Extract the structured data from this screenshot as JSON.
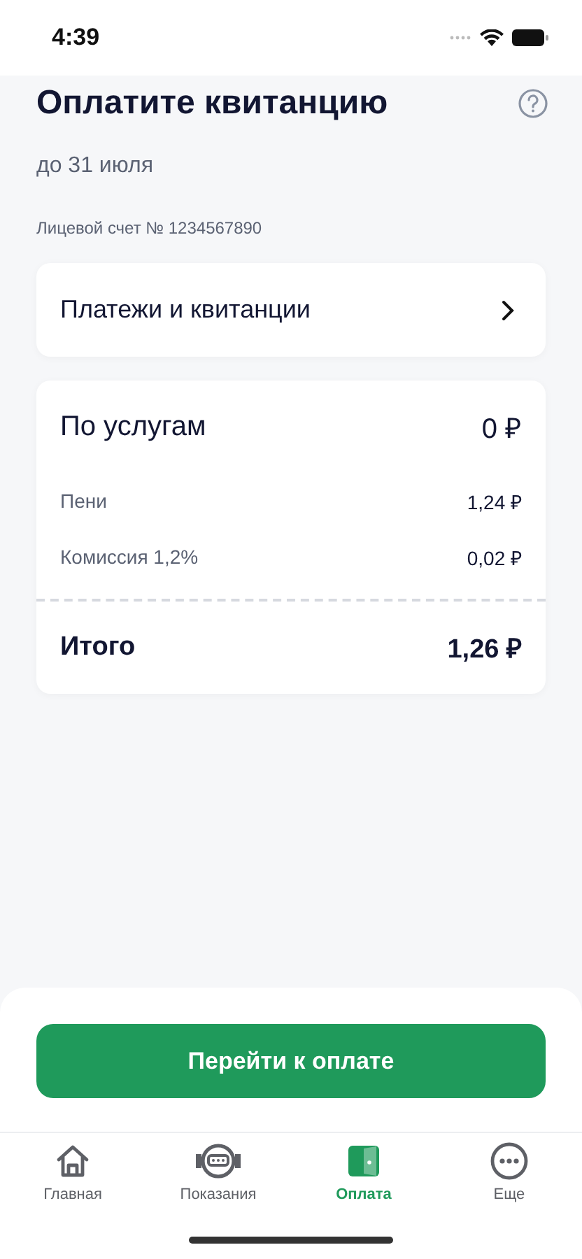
{
  "status_bar": {
    "time": "4:39"
  },
  "header": {
    "title": "Оплатите квитанцию",
    "due": "до 31 июля",
    "account": "Лицевой счет № 1234567890"
  },
  "payments_link": {
    "label": "Платежи и квитанции"
  },
  "summary": {
    "services": {
      "label": "По услугам",
      "amount": "0 ₽"
    },
    "lines": [
      {
        "label": "Пени",
        "amount": "1,24 ₽"
      },
      {
        "label": "Комиссия 1,2%",
        "amount": "0,02 ₽"
      }
    ],
    "total": {
      "label": "Итого",
      "amount": "1,26 ₽"
    }
  },
  "pay_button": "Перейти к оплате",
  "tab_bar": [
    {
      "kind": "home",
      "label": "Главная",
      "selected": false
    },
    {
      "kind": "meter",
      "label": "Показания",
      "selected": false
    },
    {
      "kind": "wallet",
      "label": "Оплата",
      "selected": true
    },
    {
      "kind": "more",
      "label": "Еще",
      "selected": false
    }
  ]
}
